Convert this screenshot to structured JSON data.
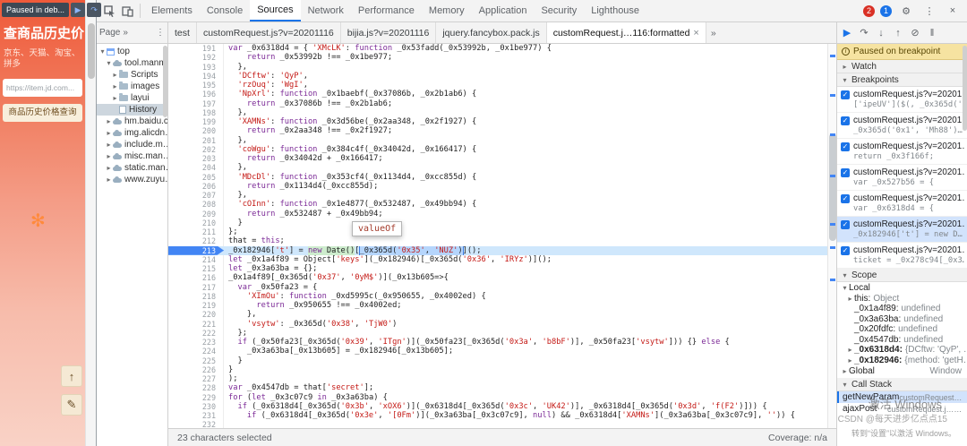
{
  "page": {
    "paused_label": "Paused in deb...",
    "title": "查商品历史价",
    "subtitle": "京东、天猫、淘宝、拼多",
    "url_value": "https://item.jd.com...",
    "search_button": "商品历史价格查询"
  },
  "watermarks": {
    "activate": "激活 Windows",
    "csdn": "CSDN @每天进步亿点点15",
    "goto": "转到“设置”以激活 Windows。"
  },
  "devtools": {
    "main_toolbar": {
      "tabs": [
        {
          "label": "Elements"
        },
        {
          "label": "Console"
        },
        {
          "label": "Sources",
          "active": true
        },
        {
          "label": "Network"
        },
        {
          "label": "Performance"
        },
        {
          "label": "Memory"
        },
        {
          "label": "Application"
        },
        {
          "label": "Security"
        },
        {
          "label": "Lighthouse"
        }
      ],
      "error_count": "2",
      "issue_count": "1",
      "icons": [
        "settings",
        "more",
        "close"
      ]
    },
    "navigator": {
      "header": "Page",
      "tree": [
        {
          "label": "top",
          "icon": "frame",
          "exp": "open",
          "depth": 0
        },
        {
          "label": "tool.manm…",
          "icon": "domain",
          "exp": "open",
          "depth": 1
        },
        {
          "label": "Scripts",
          "icon": "folder",
          "exp": "closed",
          "depth": 2
        },
        {
          "label": "images",
          "icon": "folder",
          "exp": "closed",
          "depth": 2
        },
        {
          "label": "layui",
          "icon": "folder",
          "exp": "closed",
          "depth": 2
        },
        {
          "label": "History",
          "icon": "doc",
          "exp": "none",
          "depth": 2,
          "selected": true
        },
        {
          "label": "hm.baidu.c…",
          "icon": "domain",
          "exp": "closed",
          "depth": 1
        },
        {
          "label": "img.alicdn…",
          "icon": "domain",
          "exp": "closed",
          "depth": 1
        },
        {
          "label": "include.m…",
          "icon": "domain",
          "exp": "closed",
          "depth": 1
        },
        {
          "label": "misc.man…",
          "icon": "domain",
          "exp": "closed",
          "depth": 1
        },
        {
          "label": "static.man…",
          "icon": "domain",
          "exp": "closed",
          "depth": 1
        },
        {
          "label": "www.zuyu…",
          "icon": "domain",
          "exp": "closed",
          "depth": 1
        }
      ]
    },
    "editor": {
      "tabs": [
        {
          "label": "test"
        },
        {
          "label": "customRequest.js?v=20201116"
        },
        {
          "label": "bijia.js?v=20201116"
        },
        {
          "label": "jquery.fancybox.pack.js"
        },
        {
          "label": "customRequest.j…116:formatted",
          "active": true
        }
      ],
      "status_left": "23 characters selected",
      "status_right": "Coverage: n/a",
      "tooltip": "valueOf",
      "paused_line": 213,
      "paused_parts": {
        "before": "_0x182946['t'] = ",
        "exec": "new Date()",
        "mid": "[",
        "selected": "_0x365d('0x35', 'NUZ')",
        "after": "]();"
      },
      "lines": [
        {
          "n": 191,
          "t": "var _0x6318d4 = { 'XMcLK': function _0x53fadd(_0x53992b, _0x1be977) {"
        },
        {
          "n": 192,
          "t": "    return _0x53992b !== _0x1be977;"
        },
        {
          "n": 193,
          "t": "  },"
        },
        {
          "n": 194,
          "t": "  'DCftw': 'QyP',"
        },
        {
          "n": 195,
          "t": "  'rzOuq': 'WgI',"
        },
        {
          "n": 196,
          "t": "  'NpXrl': function _0x1baebf(_0x37086b, _0x2b1ab6) {"
        },
        {
          "n": 197,
          "t": "    return _0x37086b !== _0x2b1ab6;"
        },
        {
          "n": 198,
          "t": "  },"
        },
        {
          "n": 199,
          "t": "  'XAMNs': function _0x3d56be(_0x2aa348, _0x2f1927) {"
        },
        {
          "n": 200,
          "t": "    return _0x2aa348 !== _0x2f1927;"
        },
        {
          "n": 201,
          "t": "  },"
        },
        {
          "n": 202,
          "t": "  'coWgu': function _0x384c4f(_0x34042d, _0x166417) {"
        },
        {
          "n": 203,
          "t": "    return _0x34042d + _0x166417;"
        },
        {
          "n": 204,
          "t": "  },"
        },
        {
          "n": 205,
          "t": "  'MDcDl': function _0x353cf4(_0x1134d4, _0xcc855d) {"
        },
        {
          "n": 206,
          "t": "    return _0x1134d4(_0xcc855d);"
        },
        {
          "n": 207,
          "t": "  },"
        },
        {
          "n": 208,
          "t": "  'cOInn': function _0x1e4877(_0x532487, _0x49bb94) {"
        },
        {
          "n": 209,
          "t": "    return _0x532487 + _0x49bb94;"
        },
        {
          "n": 210,
          "t": "  }"
        },
        {
          "n": 211,
          "t": "};"
        },
        {
          "n": 212,
          "t": "that = this;"
        },
        {
          "n": 213,
          "t": "_0x182946['t'] = new Date()[_0x365d('0x35', 'NUZ')]();"
        },
        {
          "n": 214,
          "t": "let _0x1a4f89 = Object['keys'](_0x182946)[_0x365d('0x36', 'IRYz')]();"
        },
        {
          "n": 215,
          "t": "let _0x3a63ba = {};"
        },
        {
          "n": 216,
          "t": "_0x1a4f89[_0x365d('0x37', '0yM$')](_0x13b605=>{"
        },
        {
          "n": 217,
          "t": "  var _0x50fa23 = {"
        },
        {
          "n": 218,
          "t": "    'XImOu': function _0xd5995c(_0x950655, _0x4002ed) {"
        },
        {
          "n": 219,
          "t": "      return _0x950655 !== _0x4002ed;"
        },
        {
          "n": 220,
          "t": "    },"
        },
        {
          "n": 221,
          "t": "    'vsytw': _0x365d('0x38', 'TjW0')"
        },
        {
          "n": 222,
          "t": "  };"
        },
        {
          "n": 223,
          "t": "  if (_0x50fa23[_0x365d('0x39', 'ITgn')](_0x50fa23[_0x365d('0x3a', 'b8bF')], _0x50fa23['vsytw'])) {} else {"
        },
        {
          "n": 224,
          "t": "    _0x3a63ba[_0x13b605] = _0x182946[_0x13b605];"
        },
        {
          "n": 225,
          "t": "  }"
        },
        {
          "n": 226,
          "t": "}"
        },
        {
          "n": 227,
          "t": ");"
        },
        {
          "n": 228,
          "t": "var _0x4547db = that['secret'];"
        },
        {
          "n": 229,
          "t": "for (let _0x3c07c9 in _0x3a63ba) {"
        },
        {
          "n": 230,
          "t": "  if (_0x6318d4[_0x365d('0x3b', 'xOX6')](_0x6318d4[_0x365d('0x3c', 'UK42')], _0x6318d4[_0x365d('0x3d', 'f(F2')])) {"
        },
        {
          "n": 231,
          "t": "    if (_0x6318d4[_0x365d('0x3e', '[0Fm')](_0x3a63ba[_0x3c07c9], null) && _0x6318d4['XAMNs'](_0x3a63ba[_0x3c07c9], '')) {"
        },
        {
          "n": 232,
          "t": ""
        }
      ]
    },
    "debugger": {
      "toolbar_icons": [
        "resume",
        "step-over",
        "step-into",
        "step-out",
        "deactivate-breakpoints",
        "pause-on-exceptions"
      ],
      "paused_message": "Paused on breakpoint",
      "watch_label": "Watch",
      "breakpoints_label": "Breakpoints",
      "breakpoints": [
        {
          "file": "customRequest.js?v=20201…",
          "snippet": "['ipeUV']($(, _0x365d('0…"
        },
        {
          "file": "customRequest.js?v=20201…",
          "snippet": "_0x365d('0x1', 'Mh88')…"
        },
        {
          "file": "customRequest.js?v=20201…",
          "snippet": "return _0x3f166f;"
        },
        {
          "file": "customRequest.js?v=20201…",
          "snippet": "var _0x527b56 = {"
        },
        {
          "file": "customRequest.js?v=20201…",
          "snippet": "var _0x6318d4 = {"
        },
        {
          "file": "customRequest.js?v=20201…",
          "snippet": "_0x182946['t'] = new D…",
          "active": true
        },
        {
          "file": "customRequest.js?v=20201…",
          "snippet": "ticket = _0x278c94[_0x3…"
        }
      ],
      "scope_label": "Scope",
      "scope": {
        "local_label": "Local",
        "locals": [
          {
            "name": "this",
            "value": "Object",
            "expandable": true
          },
          {
            "name": "_0x1a4f89",
            "value": "undefined"
          },
          {
            "name": "_0x3a63ba",
            "value": "undefined"
          },
          {
            "name": "_0x20fdfc",
            "value": "undefined"
          },
          {
            "name": "_0x4547db",
            "value": "undefined"
          },
          {
            "name": "_0x6318d4",
            "value": "{DCftw: 'QyP', …",
            "expandable": true,
            "bold": true
          },
          {
            "name": "_0x182946",
            "value": "{method: 'getH…",
            "expandable": true,
            "bold": true
          }
        ],
        "global_label": "Global",
        "global_value": "Window"
      },
      "callstack_label": "Call Stack",
      "frames": [
        {
          "name": "getNewParam",
          "location": "customRequest.j…:formatted:213",
          "active": true
        },
        {
          "name": "ajaxPost",
          "location": "customRequest.j…:formatted:15"
        }
      ]
    }
  }
}
